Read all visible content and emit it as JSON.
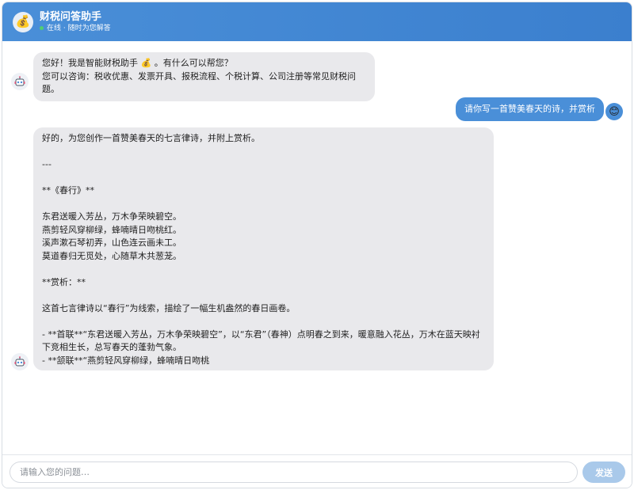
{
  "header": {
    "avatar_icon": "💰",
    "title": "财税问答助手",
    "status": "在线 · 随时为您解答"
  },
  "messages": [
    {
      "role": "bot",
      "text": "您好！我是智能财税助手 💰 。有什么可以帮您？\n您可以咨询：税收优惠、发票开具、报税流程、个税计算、公司注册等常见财税问题。"
    },
    {
      "role": "user",
      "text": "请你写一首赞美春天的诗，并赏析"
    },
    {
      "role": "bot",
      "text": "好的，为您创作一首赞美春天的七言律诗，并附上赏析。\n\n---\n\n**《春行》**\n\n东君送暖入芳丛，万木争荣映碧空。\n燕剪轻风穿柳绿，蜂喃晴日吻桃红。\n溪声漱石琴初弄，山色连云画未工。\n莫道春归无觅处，心随草木共葱茏。\n\n**赏析：**\n\n这首七言律诗以“春行”为线索，描绘了一幅生机盎然的春日画卷。\n\n- **首联**“东君送暖入芳丛，万木争荣映碧空”，以“东君”（春神）点明春之到来，暖意融入花丛，万木在蓝天映衬下竞相生长，总写春天的蓬勃气象。\n- **颔联**“燕剪轻风穿柳绿，蜂喃晴日吻桃"
    }
  ],
  "user_avatar_icon": "😊",
  "input": {
    "placeholder": "请输入您的问题…",
    "value": ""
  },
  "send_label": "发送",
  "colors": {
    "header": "#4a8fd8",
    "user_bubble": "#4a8fd8",
    "bot_bubble": "#e9e9ec",
    "send_button": "#a9c9ea",
    "status_dot": "#52d36b"
  }
}
